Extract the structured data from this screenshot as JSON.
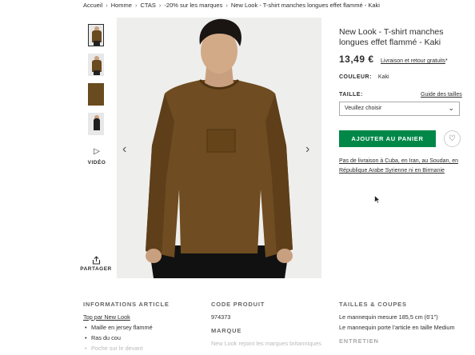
{
  "breadcrumb": [
    "Accueil",
    "Homme",
    "CTAS",
    "-20% sur les marques",
    "New Look - T-shirt manches longues effet flammé - Kaki"
  ],
  "gallery": {
    "thumbnails": [
      "thumbnail-1",
      "thumbnail-2",
      "thumbnail-3",
      "thumbnail-4"
    ],
    "video_label": "VIDÉO",
    "share_label": "PARTAGER"
  },
  "product": {
    "title": "New Look - T-shirt manches longues effet flammé - Kaki",
    "price": "13,49 €",
    "shipping": "Livraison et retour gratuits",
    "shipping_suffix": "*",
    "color_label": "COULEUR:",
    "color_value": "Kaki",
    "size_label": "TAILLE:",
    "size_guide": "Guide des tailles",
    "size_placeholder": "Veuillez choisir",
    "add_to_bag": "AJOUTER AU PANIER",
    "delivery_note": "Pas de livraison à Cuba, en Iran, au Soudan, en République Arabe Syrienne ni en Birmanie"
  },
  "info": {
    "col1": {
      "heading": "INFORMATIONS ARTICLE",
      "lead_prefix": "Top par ",
      "lead_link": "New Look",
      "bullets": [
        "Maille en jersey flammé",
        "Ras du cou",
        "Poche sur le devant"
      ]
    },
    "col2": {
      "heading": "CODE PRODUIT",
      "code": "974373",
      "brand_heading": "MARQUE",
      "brand_text": "New Look rejoint les marques britanniques"
    },
    "col3": {
      "heading": "TAILLES & COUPES",
      "line1": "Le mannequin mesure 185,5 cm (6'1\")",
      "line2": "Le mannequin porte l'article en taille Medium",
      "care_heading": "ENTRETIEN"
    }
  },
  "colors": {
    "accent_green": "#018849",
    "text": "#2d2d2d",
    "sweater": "#6a4a1f"
  }
}
